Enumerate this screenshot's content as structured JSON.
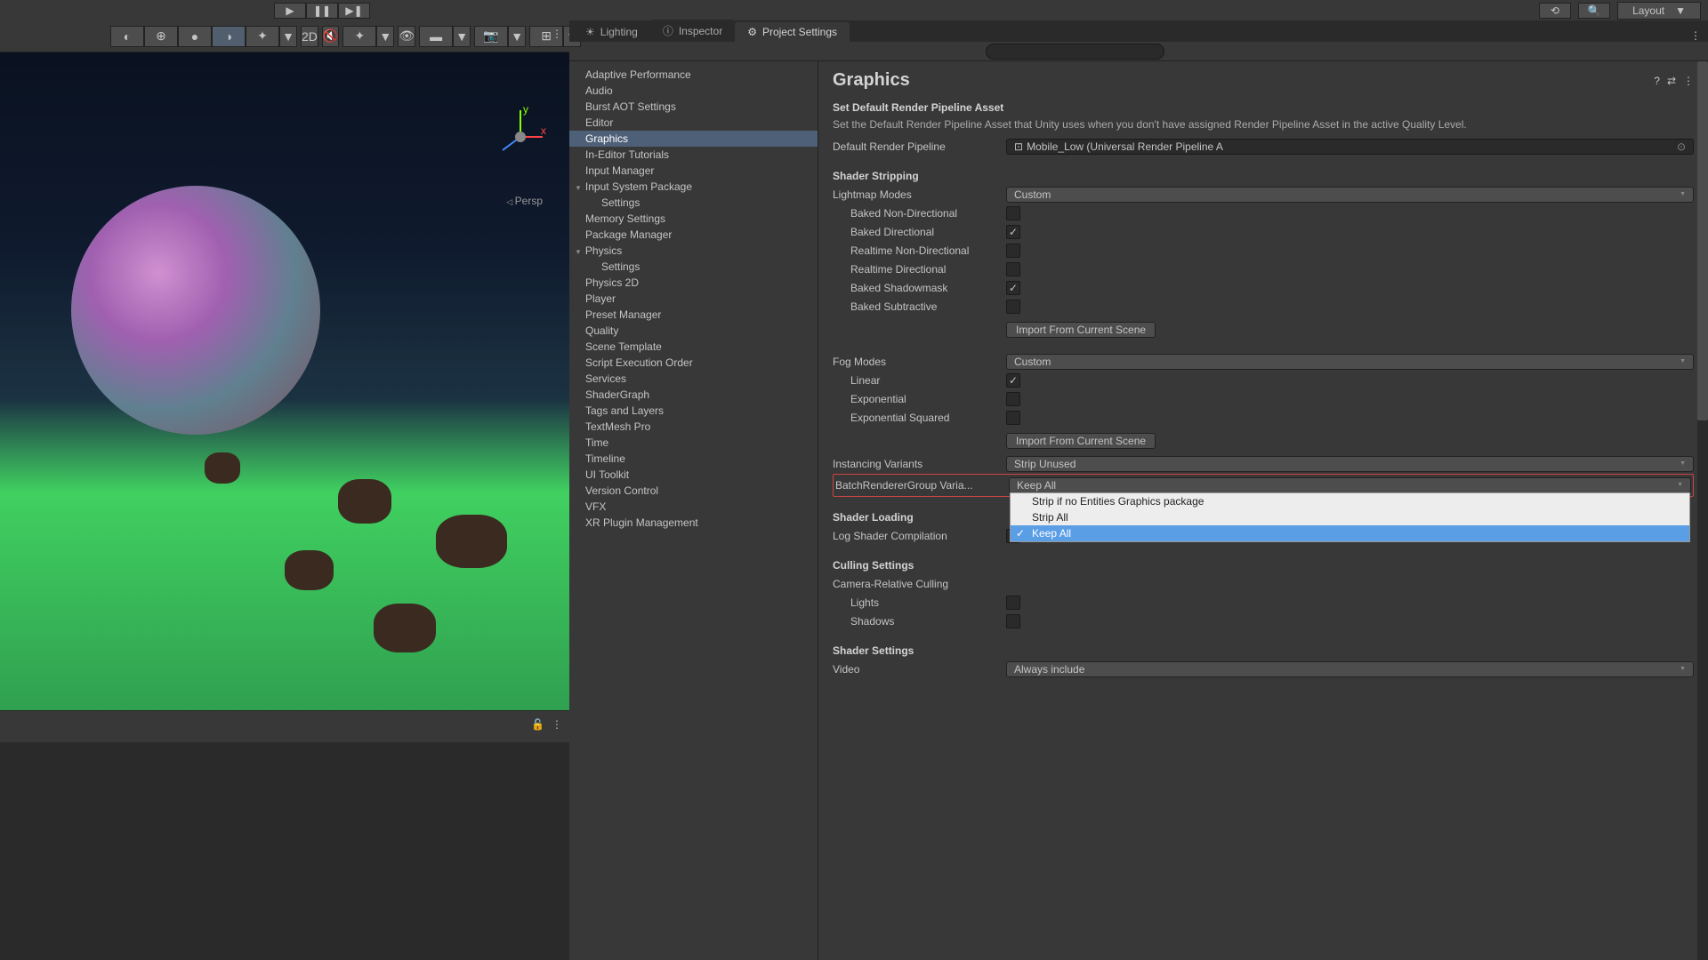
{
  "toolbar": {
    "layout_label": "Layout"
  },
  "tabs": {
    "lighting": "Lighting",
    "inspector": "Inspector",
    "project_settings": "Project Settings"
  },
  "scene": {
    "persp_label": "Persp",
    "btn_2d": "2D"
  },
  "sidebar": {
    "items": [
      "Adaptive Performance",
      "Audio",
      "Burst AOT Settings",
      "Editor",
      "Graphics",
      "In-Editor Tutorials",
      "Input Manager",
      "Input System Package",
      "Settings",
      "Memory Settings",
      "Package Manager",
      "Physics",
      "Settings",
      "Physics 2D",
      "Player",
      "Preset Manager",
      "Quality",
      "Scene Template",
      "Script Execution Order",
      "Services",
      "ShaderGraph",
      "Tags and Layers",
      "TextMesh Pro",
      "Time",
      "Timeline",
      "UI Toolkit",
      "Version Control",
      "VFX",
      "XR Plugin Management"
    ]
  },
  "graphics": {
    "title": "Graphics",
    "section_render": "Set Default Render Pipeline Asset",
    "desc_render": "Set the Default Render Pipeline Asset that Unity uses when you don't have assigned Render Pipeline Asset in the active Quality Level.",
    "label_default_pipeline": "Default Render Pipeline",
    "value_default_pipeline": "Mobile_Low (Universal Render Pipeline A",
    "section_shader_stripping": "Shader Stripping",
    "label_lightmap_modes": "Lightmap Modes",
    "value_lightmap_modes": "Custom",
    "label_baked_non_dir": "Baked Non-Directional",
    "label_baked_dir": "Baked Directional",
    "label_realtime_non_dir": "Realtime Non-Directional",
    "label_realtime_dir": "Realtime Directional",
    "label_baked_shadowmask": "Baked Shadowmask",
    "label_baked_subtractive": "Baked Subtractive",
    "btn_import": "Import From Current Scene",
    "label_fog_modes": "Fog Modes",
    "value_fog_modes": "Custom",
    "label_linear": "Linear",
    "label_exponential": "Exponential",
    "label_exp_squared": "Exponential Squared",
    "label_instancing": "Instancing Variants",
    "value_instancing": "Strip Unused",
    "label_brg": "BatchRendererGroup Varia...",
    "value_brg": "Keep All",
    "brg_options": [
      "Strip if no Entities Graphics package",
      "Strip All",
      "Keep All"
    ],
    "section_shader_loading": "Shader Loading",
    "label_log_shader": "Log Shader Compilation",
    "section_culling": "Culling Settings",
    "label_camera_culling": "Camera-Relative Culling",
    "label_lights": "Lights",
    "label_shadows": "Shadows",
    "section_shader_settings": "Shader Settings",
    "label_video": "Video",
    "value_video": "Always include"
  }
}
